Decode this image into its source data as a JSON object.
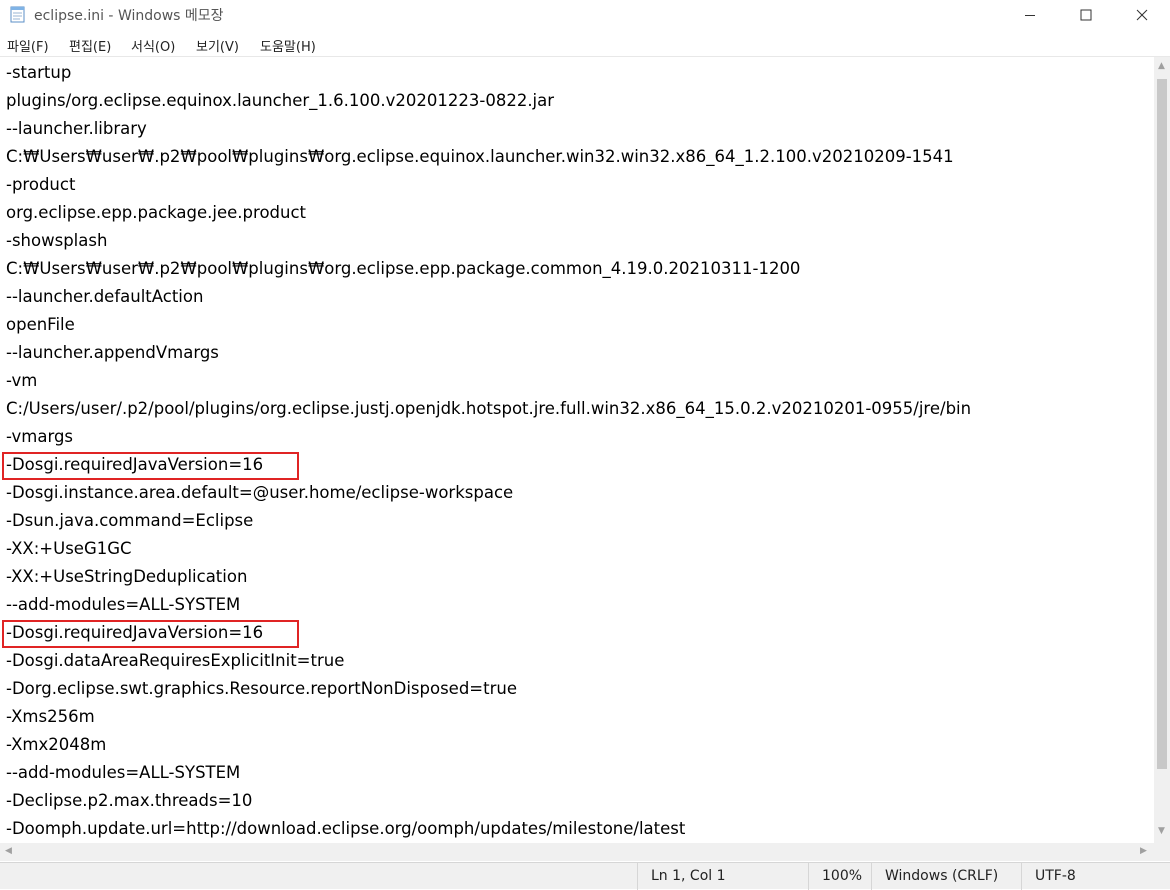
{
  "window": {
    "title": "eclipse.ini - Windows 메모장",
    "icon": "notepad-icon",
    "controls": [
      "minimize-icon",
      "maximize-icon",
      "close-icon"
    ]
  },
  "menu": [
    "파일(F)",
    "편집(E)",
    "서식(O)",
    "보기(V)",
    "도움말(H)"
  ],
  "lines": [
    "-startup",
    "plugins/org.eclipse.equinox.launcher_1.6.100.v20201223-0822.jar",
    "--launcher.library",
    "C:₩Users₩user₩.p2₩pool₩plugins₩org.eclipse.equinox.launcher.win32.win32.x86_64_1.2.100.v20210209-1541",
    "-product",
    "org.eclipse.epp.package.jee.product",
    "-showsplash",
    "C:₩Users₩user₩.p2₩pool₩plugins₩org.eclipse.epp.package.common_4.19.0.20210311-1200",
    "--launcher.defaultAction",
    "openFile",
    "--launcher.appendVmargs",
    "-vm",
    "C:/Users/user/.p2/pool/plugins/org.eclipse.justj.openjdk.hotspot.jre.full.win32.x86_64_15.0.2.v20210201-0955/jre/bin",
    "-vmargs",
    "-Dosgi.requiredJavaVersion=16",
    "-Dosgi.instance.area.default=@user.home/eclipse-workspace",
    "-Dsun.java.command=Eclipse",
    "-XX:+UseG1GC",
    "-XX:+UseStringDeduplication",
    "--add-modules=ALL-SYSTEM",
    "-Dosgi.requiredJavaVersion=16",
    "-Dosgi.dataAreaRequiresExplicitInit=true",
    "-Dorg.eclipse.swt.graphics.Resource.reportNonDisposed=true",
    "-Xms256m",
    "-Xmx2048m",
    "--add-modules=ALL-SYSTEM",
    "-Declipse.p2.max.threads=10",
    "-Doomph.update.url=http://download.eclipse.org/oomph/updates/milestone/latest"
  ],
  "highlighted_lines": [
    14,
    20
  ],
  "highlight_color": "#e02424",
  "status": {
    "position": "Ln 1, Col 1",
    "zoom": "100%",
    "line_ending": "Windows (CRLF)",
    "encoding": "UTF-8"
  }
}
